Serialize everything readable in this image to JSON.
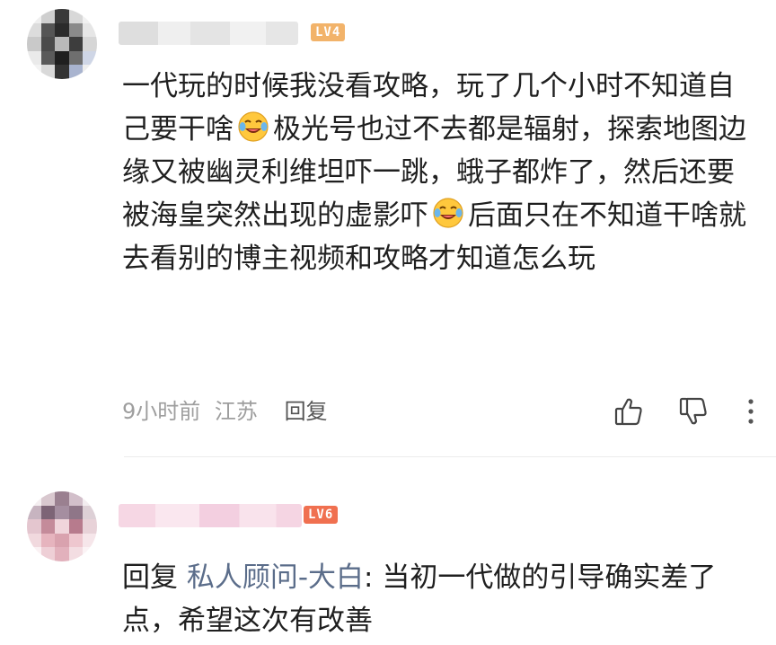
{
  "comments": [
    {
      "username": "",
      "level": "LV4",
      "body": {
        "part1": "一代玩的时候我没看攻略，玩了几个小时不知道自己要干啥",
        "part2": "极光号也过不去都是辐射，探索地图边缘又被幽灵利维坦吓一跳，蛾子都炸了，然后还要被海皇突然出现的虚影吓",
        "part3": "后面只在不知道干啥就去看别的博主视频和攻略才知道怎么玩",
        "emoji_icon": "laughing-crying-emoji-icon"
      },
      "time": "9小时前",
      "location": "江苏",
      "reply_label": "回复"
    },
    {
      "username": "",
      "level": "LV6",
      "reply_prefix": "回复",
      "reply_to": "私人顾问-大白",
      "body": ": 当初一代做的引导确实差了点，希望这次有改善"
    }
  ],
  "icons": {
    "like": "thumbs-up-icon",
    "dislike": "thumbs-down-icon",
    "more": "more-vertical-icon"
  },
  "colors": {
    "lv4_badge": "#f2b36a",
    "lv6_badge": "#f07050",
    "reply_to_name": "#5b6d8a",
    "meta_text": "#9e9e9e"
  }
}
